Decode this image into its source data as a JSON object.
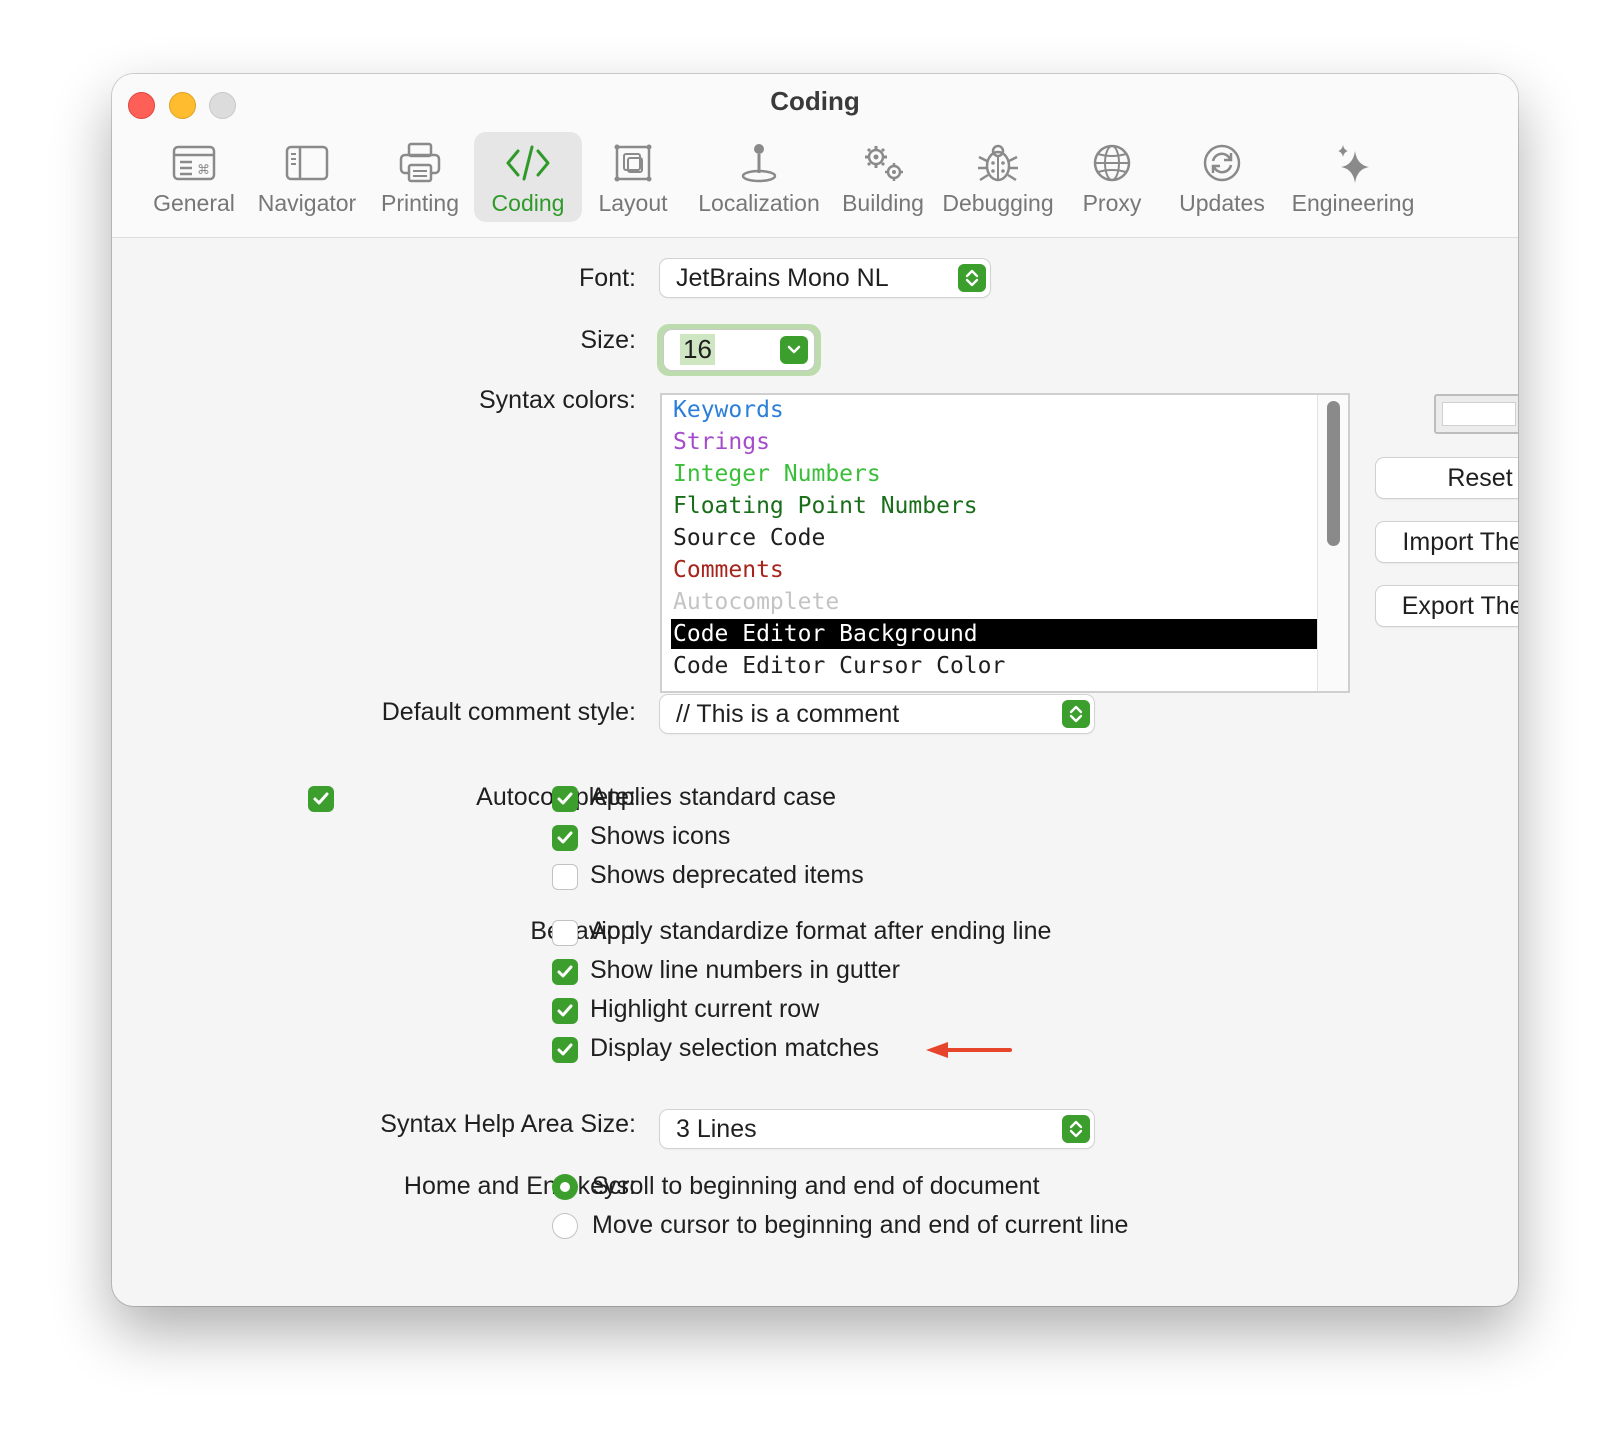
{
  "window": {
    "title": "Coding"
  },
  "toolbar": {
    "tabs": [
      {
        "label": "General",
        "icon": "general-icon"
      },
      {
        "label": "Navigator",
        "icon": "sidebar-icon"
      },
      {
        "label": "Printing",
        "icon": "printer-icon"
      },
      {
        "label": "Coding",
        "icon": "code-brackets-icon",
        "active": true
      },
      {
        "label": "Layout",
        "icon": "layout-icon"
      },
      {
        "label": "Localization",
        "icon": "joystick-icon"
      },
      {
        "label": "Building",
        "icon": "gears-icon"
      },
      {
        "label": "Debugging",
        "icon": "bug-icon"
      },
      {
        "label": "Proxy",
        "icon": "globe-icon"
      },
      {
        "label": "Updates",
        "icon": "refresh-icon"
      },
      {
        "label": "Engineering",
        "icon": "sparkles-icon"
      }
    ]
  },
  "form": {
    "font_label": "Font:",
    "font_value": "JetBrains Mono NL",
    "size_label": "Size:",
    "size_value": "16",
    "syntax_label": "Syntax colors:",
    "syntax_items": [
      {
        "label": "Keywords",
        "color": "#2b7fd9"
      },
      {
        "label": "Strings",
        "color": "#a54ccc"
      },
      {
        "label": "Integer Numbers",
        "color": "#3bbf3b"
      },
      {
        "label": "Floating Point Numbers",
        "color": "#1a6e1a"
      },
      {
        "label": "Source Code",
        "color": "#1f1f1f"
      },
      {
        "label": "Comments",
        "color": "#a8231c"
      },
      {
        "label": "Autocomplete",
        "color": "#c4c4c4"
      },
      {
        "label": "Code Editor Background",
        "color": "#ffffff",
        "selected": true
      },
      {
        "label": "Code Editor Cursor Color",
        "color": "#1f1f1f"
      }
    ],
    "buttons": {
      "reset": "Reset",
      "import": "Import Theme",
      "export": "Export Theme"
    },
    "comment_style_label": "Default comment style:",
    "comment_style_value": "// This is a comment",
    "autocomplete_label": "Autocomplete:",
    "autocomplete_enabled": true,
    "autocomplete_options": [
      {
        "label": "Applies standard case",
        "checked": true
      },
      {
        "label": "Shows icons",
        "checked": true
      },
      {
        "label": "Shows deprecated items",
        "checked": false
      }
    ],
    "behavior_label": "Behavior:",
    "behavior_options": [
      {
        "label": "Apply standardize format after ending line",
        "checked": false
      },
      {
        "label": "Show line numbers in gutter",
        "checked": true
      },
      {
        "label": "Highlight current row",
        "checked": true
      },
      {
        "label": "Display selection matches",
        "checked": true
      }
    ],
    "help_area_label": "Syntax Help Area Size:",
    "help_area_value": "3 Lines",
    "home_end_label": "Home and End keys:",
    "home_end_options": [
      {
        "label": "Scroll to beginning and end of document",
        "selected": true
      },
      {
        "label": "Move cursor to beginning and end of current line",
        "selected": false
      }
    ]
  },
  "colors": {
    "accent": "#3c9e2d",
    "annotation_arrow": "#e6452c"
  }
}
